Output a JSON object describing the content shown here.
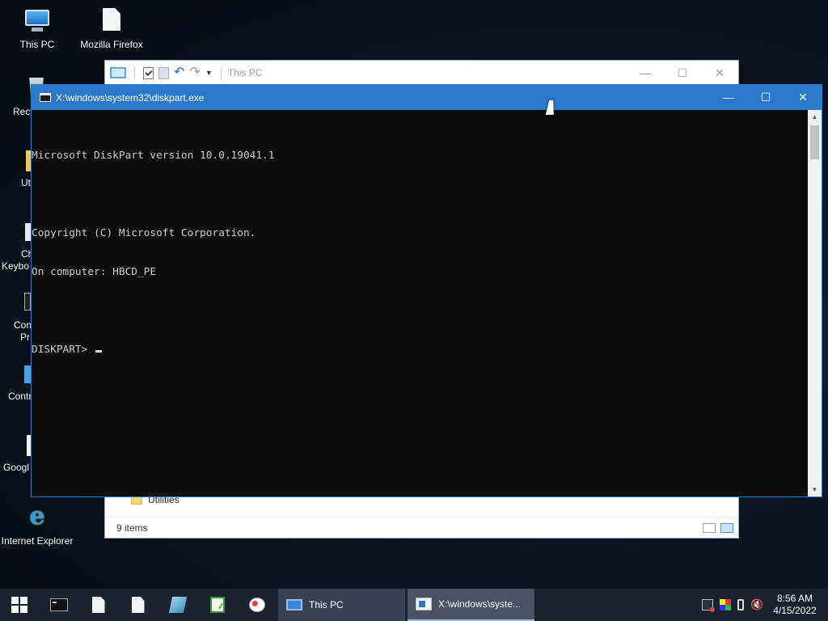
{
  "desktop": {
    "icons": [
      {
        "label": "This PC"
      },
      {
        "label": "Mozilla Firefox"
      },
      {
        "label": "Internet Explorer"
      }
    ],
    "partial_labels": [
      "Recy",
      "Ut",
      "Ch",
      "Keybo",
      "Con",
      "Pr",
      "Contr",
      "Googl"
    ]
  },
  "explorer": {
    "title": "This PC",
    "folder_item": "Utilities",
    "status": "9 items"
  },
  "console": {
    "title": "X:\\windows\\system32\\diskpart.exe",
    "lines": [
      "Microsoft DiskPart version 10.0.19041.1",
      "",
      "Copyright (C) Microsoft Corporation.",
      "On computer: HBCD_PE",
      "",
      "DISKPART> "
    ]
  },
  "window_buttons": {
    "minimize": "—",
    "maximize": "☐",
    "close": "✕"
  },
  "taskbar": {
    "tasks": [
      {
        "label": "This PC"
      },
      {
        "label": "X:\\windows\\syste..."
      }
    ],
    "clock": {
      "time": "8:56 AM",
      "date": "4/15/2022"
    }
  }
}
